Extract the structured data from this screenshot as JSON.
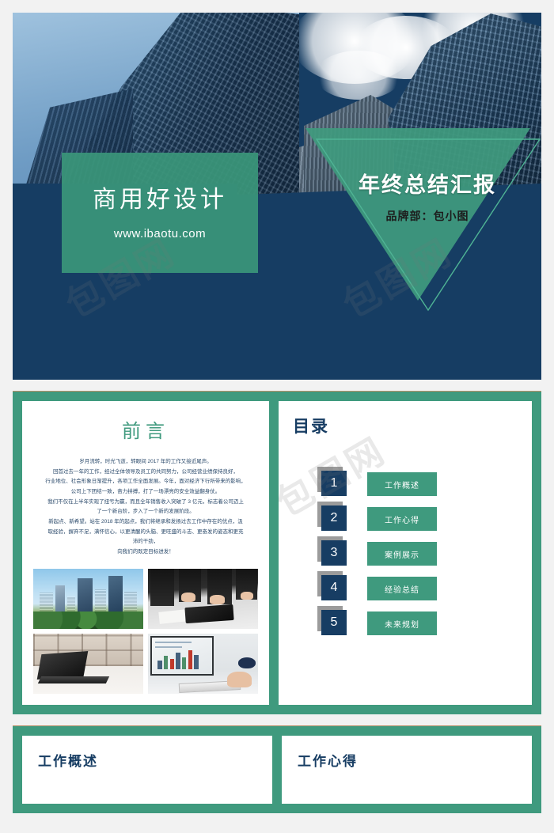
{
  "hero": {
    "left_card": {
      "title": "商用好设计",
      "url": "www.ibaotu.com"
    },
    "right": {
      "title": "年终总结汇报",
      "subtitle": "品牌部：包小图"
    },
    "colors": {
      "navy": "#163d63",
      "teal": "#3f9a7e"
    }
  },
  "preface": {
    "title": "前言",
    "paragraphs": [
      "岁月流转，时光飞逝，转眼间 2017 年的工作又接近尾声。",
      "回首过去一年的工作，经过全体领导及员工的共同努力，公司经营业绩保持良好，",
      "行业地位、社会形象日渐提升，各项工作全面发展。今年，面对经济下行所带来的影响，",
      "公司上下团结一致，奋力拼搏，打了一场漂亮的安全效益翻身仗。",
      "我们不仅在上半年实现了扭亏为赢，而且全年销售收入突破了 3 亿元，标志着公司迈上",
      "了一个新台阶，步入了一个新的发展阶段。",
      "新起点、新希望。站在 2018 年的起点，我们将继承和发扬过去工作中存在的优点，汲",
      "取经验，摒弃不足，满怀信心，以更清醒的头脑、更旺盛的斗志、更奋发的姿态和更充",
      "沛的干劲，",
      "向我们的既定目标进发！"
    ],
    "images": [
      {
        "name": "city-skyline-photo",
        "alt": "城市高楼与绿树"
      },
      {
        "name": "business-meeting-photo",
        "alt": "商务会议桌面与平板"
      },
      {
        "name": "laptop-desk-photo",
        "alt": "办公桌上的笔记本电脑"
      },
      {
        "name": "data-monitor-photo",
        "alt": "显示数据图表的显示器与键盘"
      }
    ]
  },
  "contents": {
    "title": "目录",
    "items": [
      {
        "number": "1",
        "label": "工作概述"
      },
      {
        "number": "2",
        "label": "工作心得"
      },
      {
        "number": "3",
        "label": "案例展示"
      },
      {
        "number": "4",
        "label": "经验总结"
      },
      {
        "number": "5",
        "label": "未来规划"
      }
    ]
  },
  "sections": [
    {
      "heading": "工作概述"
    },
    {
      "heading": "工作心得"
    }
  ],
  "watermark": {
    "text": "包图网"
  }
}
